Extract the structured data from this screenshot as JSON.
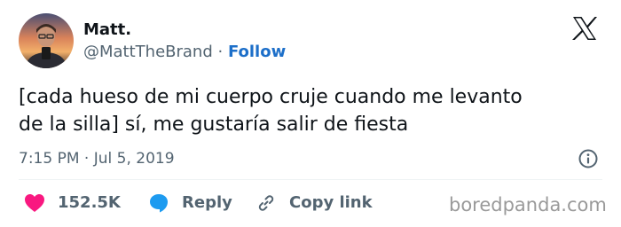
{
  "user": {
    "display_name": "Matt.",
    "handle": "@MattTheBrand",
    "separator": " · ",
    "follow_label": "Follow"
  },
  "tweet": {
    "line1": "[cada hueso de mi cuerpo cruje cuando me levanto",
    "line2": "de la silla] sí, me gustaría salir de fiesta",
    "timestamp": "7:15 PM · Jul 5, 2019"
  },
  "actions": {
    "like_count": "152.5K",
    "reply_label": "Reply",
    "copy_label": "Copy link"
  },
  "watermark": "boredpanda.com",
  "icons": {
    "brand": "x-logo-icon",
    "like": "heart-icon",
    "reply": "speech-bubble-icon",
    "copy": "link-icon",
    "info": "info-icon"
  },
  "colors": {
    "like": "#f91880",
    "reply": "#1d9bf0",
    "follow": "#1d6fc9",
    "muted": "#536471"
  }
}
